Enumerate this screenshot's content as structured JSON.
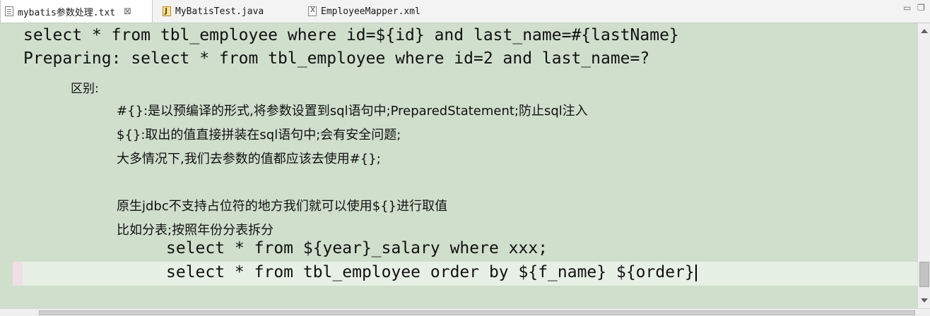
{
  "tabs": [
    {
      "label": "mybatis参数处理.txt",
      "icon": "text-file-icon",
      "active": true
    },
    {
      "label": "MyBatisTest.java",
      "icon": "java-file-icon",
      "active": false
    },
    {
      "label": "EmployeeMapper.xml",
      "icon": "xml-file-icon",
      "active": false
    }
  ],
  "tab_close_glyph": "⊠",
  "window_controls": {
    "minimize": "▭",
    "restore": "❐"
  },
  "editor": {
    "lines": [
      "select * from tbl_employee where id=${id} and last_name=#{lastName}",
      "Preparing: select * from tbl_employee where id=2 and last_name=?",
      "区别:",
      "#{}:是以预编译的形式,将参数设置到sql语句中;PreparedStatement;防止sql注入",
      "${}:取出的值直接拼装在sql语句中;会有安全问题;",
      "大多情况下,我们去参数的值都应该去使用#{};",
      "",
      "原生jdbc不支持占位符的地方我们就可以使用${}进行取值",
      "比如分表;按照年份分表拆分",
      "select * from ${year}_salary where xxx;",
      "select * from tbl_employee order by ${f_name} ${order}"
    ]
  },
  "colors": {
    "editor_background": "#cfdfcc",
    "current_line": "#e7f0e4",
    "tabbar": "#f3f3f3"
  }
}
